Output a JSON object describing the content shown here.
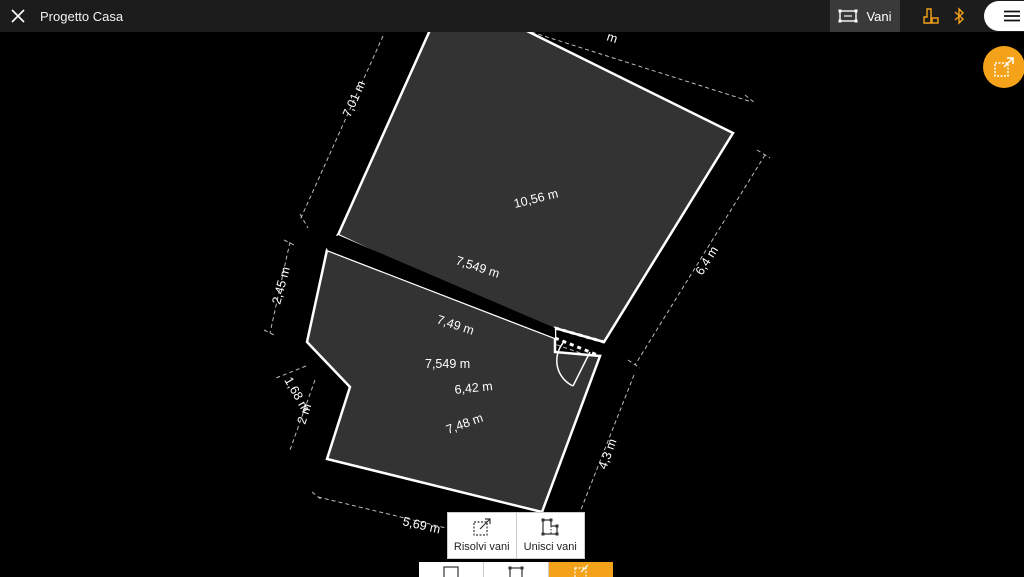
{
  "header": {
    "title": "Progetto Casa",
    "rooms_label": "Vani"
  },
  "colors": {
    "accent": "#f5a21b",
    "topbar": "#1c1c1c",
    "room_fill": "#333333"
  },
  "icons": [
    "close-icon",
    "rooms-icon",
    "level-icon",
    "bluetooth-icon",
    "menu-icon",
    "split-rooms-icon",
    "merge-rooms-icon"
  ],
  "measurements": {
    "top_wall": "m",
    "upper_left": "7,01 m",
    "upper_diagonal": "10,56 m",
    "upper_bottom": "7,549 m",
    "upper_right": "6,4 m",
    "lower_left": "2,45 m",
    "lower_top": "7,49 m",
    "lower_mid_a": "7,549 m",
    "lower_mid_b": "6,42 m",
    "notch_a": "1,68 m",
    "notch_b": "2 m",
    "lower_diagonal": "7,48 m",
    "lower_right": "4,3 m",
    "lower_bottom": "5,69 m"
  },
  "actions": {
    "split": "Risolvi vani",
    "merge": "Unisci vani"
  }
}
